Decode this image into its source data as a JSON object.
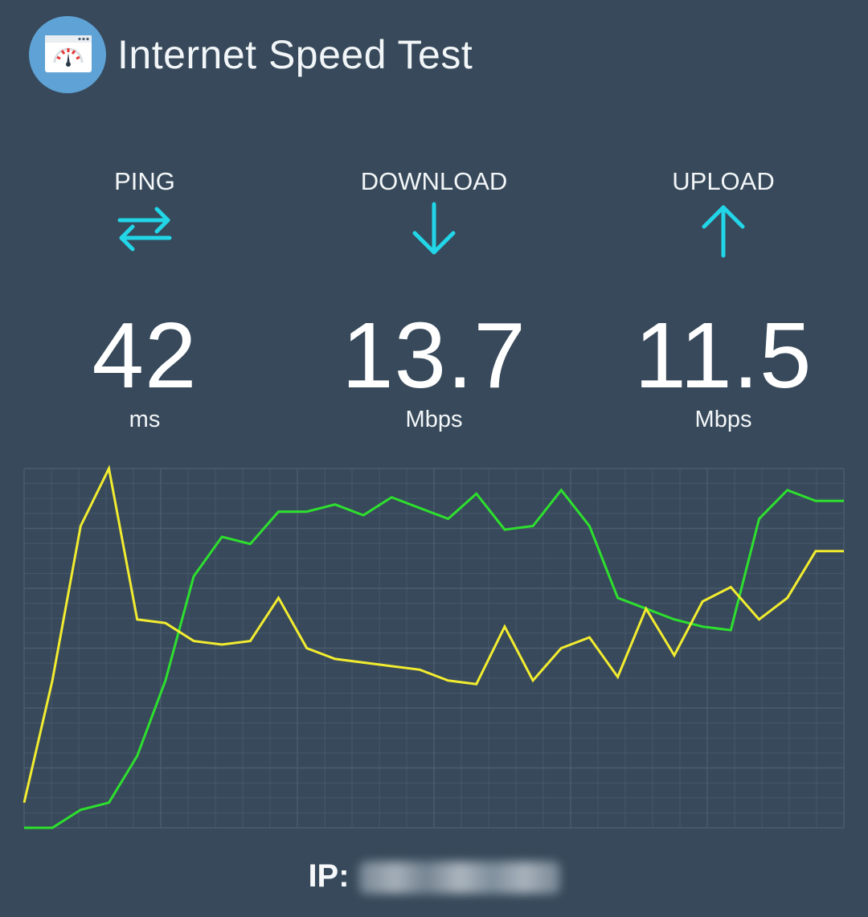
{
  "app": {
    "title": "Internet Speed Test",
    "icon": "speedometer-app-icon"
  },
  "metrics": {
    "ping": {
      "label": "PING",
      "value": "42",
      "unit": "ms",
      "icon": "swap-arrows-icon"
    },
    "download": {
      "label": "DOWNLOAD",
      "value": "13.7",
      "unit": "Mbps",
      "icon": "arrow-down-icon"
    },
    "upload": {
      "label": "UPLOAD",
      "value": "11.5",
      "unit": "Mbps",
      "icon": "arrow-up-icon"
    }
  },
  "colors": {
    "background": "#37495a",
    "accent": "#22d6e8",
    "download_line": "#2ee02e",
    "upload_line": "#f2ec30",
    "grid": "#4a5d6e"
  },
  "chart_data": {
    "type": "line",
    "x": [
      0,
      1,
      2,
      3,
      4,
      5,
      6,
      7,
      8,
      9,
      10,
      11,
      12,
      13,
      14,
      15,
      16,
      17,
      18,
      19,
      20,
      21,
      22,
      23,
      24,
      25,
      26,
      27,
      28,
      29
    ],
    "ylim": [
      0,
      100
    ],
    "grid": true,
    "series": [
      {
        "values": [
          0,
          0,
          5,
          7,
          20,
          41,
          70,
          81,
          79,
          88,
          88,
          90,
          87,
          92,
          89,
          86,
          93,
          83,
          84,
          94,
          84,
          64,
          61,
          58,
          56,
          55,
          86,
          94,
          91,
          91
        ]
      },
      {
        "values": [
          7,
          41,
          84,
          100,
          58,
          57,
          52,
          51,
          52,
          64,
          50,
          47,
          46,
          45,
          44,
          41,
          40,
          56,
          41,
          50,
          53,
          42,
          61,
          48,
          63,
          67,
          58,
          64,
          77,
          77
        ]
      }
    ]
  },
  "footer": {
    "ip_label": "IP:",
    "ip_value": ""
  }
}
